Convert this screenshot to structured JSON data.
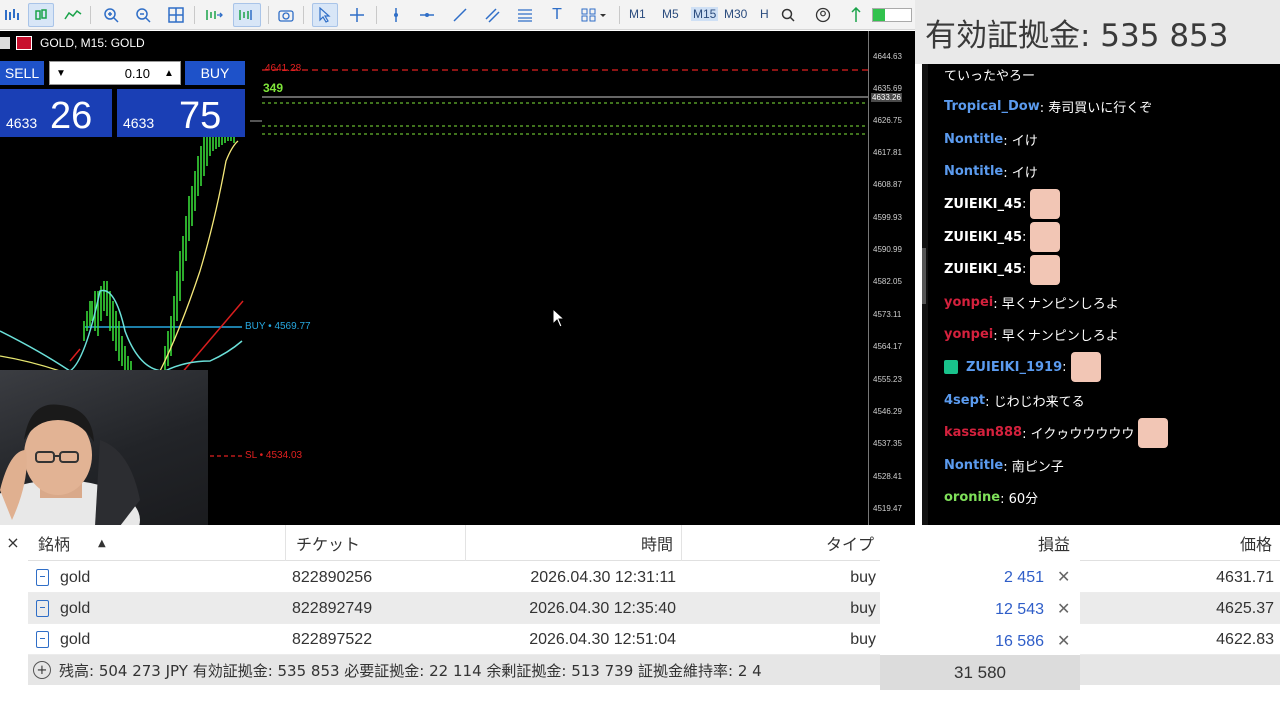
{
  "toolbar": {
    "timeframes": [
      "M1",
      "M5",
      "M15",
      "M30",
      "H"
    ],
    "active_timeframe": "M15"
  },
  "chart": {
    "title": "GOLD, M15:  GOLD",
    "sell_label": "SELL",
    "buy_label": "BUY",
    "lot_value": "0.10",
    "sell_small": "4633",
    "sell_big": "26",
    "buy_small": "4633",
    "buy_big": "75",
    "line_label_top": "4641.28",
    "line_label_spread": "349",
    "buy_line_label": "BUY • 4569.77",
    "sl_label": "SL • 4534.03",
    "price_labels": [
      "4644.63",
      "4635.69",
      "4633.26",
      "4626.75",
      "4617.81",
      "4608.87",
      "4599.93",
      "4590.99",
      "4582.05",
      "4573.11",
      "4564.17",
      "4555.23",
      "4546.29",
      "4537.35",
      "4528.41",
      "4519.47"
    ],
    "highlight_price": "4633.26"
  },
  "equity_banner": "有効証拠金: 535 853",
  "chat": [
    {
      "author": "",
      "author_color": "#ffffff",
      "text": "ていったやろー",
      "emote": false,
      "badge": false
    },
    {
      "author": "Tropical_Dow",
      "author_color": "#5b9bef",
      "text": ": 寿司買いに行くぞ",
      "emote": false,
      "badge": false
    },
    {
      "author": "Nontitle",
      "author_color": "#5b9bef",
      "text": ": イけ",
      "emote": false,
      "badge": false
    },
    {
      "author": "Nontitle",
      "author_color": "#5b9bef",
      "text": ": イけ",
      "emote": false,
      "badge": false
    },
    {
      "author": "ZUIEIKI_45",
      "author_color": "#ffffff",
      "text": ":",
      "emote": true,
      "badge": false
    },
    {
      "author": "ZUIEIKI_45",
      "author_color": "#ffffff",
      "text": ":",
      "emote": true,
      "badge": false
    },
    {
      "author": "ZUIEIKI_45",
      "author_color": "#ffffff",
      "text": ":",
      "emote": true,
      "badge": false
    },
    {
      "author": "yonpei",
      "author_color": "#d4213d",
      "text": ": 早くナンピンしろよ",
      "emote": false,
      "badge": false
    },
    {
      "author": "yonpei",
      "author_color": "#d4213d",
      "text": ": 早くナンピンしろよ",
      "emote": false,
      "badge": false
    },
    {
      "author": "ZUIEIKI_1919",
      "author_color": "#5b9bef",
      "text": ":",
      "emote": true,
      "badge": true
    },
    {
      "author": "4sept",
      "author_color": "#5b9bef",
      "text": ": じわじわ来てる",
      "emote": false,
      "badge": false
    },
    {
      "author": "kassan888",
      "author_color": "#d4213d",
      "text": ": イクゥウウウウウ",
      "emote": true,
      "badge": false
    },
    {
      "author": "Nontitle",
      "author_color": "#5b9bef",
      "text": ": 南ピン子",
      "emote": false,
      "badge": false
    },
    {
      "author": "oronine",
      "author_color": "#7fe05a",
      "text": ": 60分",
      "emote": false,
      "badge": false
    }
  ],
  "terminal": {
    "close_icon": "×",
    "headers": {
      "symbol": "銘柄",
      "ticket": "チケット",
      "time": "時間",
      "type": "タイプ",
      "profit": "損益",
      "price": "価格"
    },
    "rows": [
      {
        "symbol": "gold",
        "ticket": "822890256",
        "time": "2026.04.30 12:31:11",
        "type": "buy",
        "profit": "2 451",
        "price": "4631.71"
      },
      {
        "symbol": "gold",
        "ticket": "822892749",
        "time": "2026.04.30 12:35:40",
        "type": "buy",
        "profit": "12 543",
        "price": "4625.37"
      },
      {
        "symbol": "gold",
        "ticket": "822897522",
        "time": "2026.04.30 12:51:04",
        "type": "buy",
        "profit": "16 586",
        "price": "4622.83"
      }
    ],
    "footer": "残高: 504 273 JPY  有効証拠金: 535 853  必要証拠金: 22 114  余剰証拠金: 513 739  証拠金維持率: 2 4",
    "total": "31 580"
  }
}
